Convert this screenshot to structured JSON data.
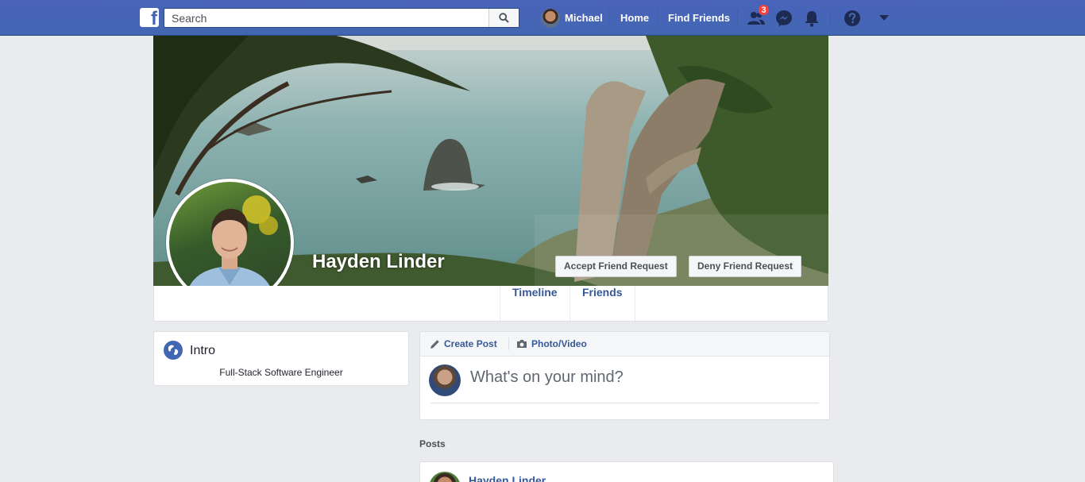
{
  "topbar": {
    "logo_letter": "f",
    "search_placeholder": "Search",
    "user_name": "Michael",
    "home_label": "Home",
    "find_friends_label": "Find Friends",
    "friend_requests_count": "3"
  },
  "profile": {
    "name": "Hayden Linder",
    "accept_label": "Accept Friend Request",
    "deny_label": "Deny Friend Request",
    "tabs": [
      "Timeline",
      "Friends"
    ]
  },
  "intro": {
    "title": "Intro",
    "bio": "Full-Stack Software Engineer"
  },
  "composer": {
    "create_post_label": "Create Post",
    "photo_video_label": "Photo/Video",
    "placeholder": "What's on your mind?"
  },
  "posts": {
    "section_label": "Posts",
    "first_author": "Hayden Linder"
  },
  "colors": {
    "brand": "#4267b2",
    "link": "#365899",
    "page_bg": "#e9ebee",
    "badge": "#fa3e3e"
  }
}
